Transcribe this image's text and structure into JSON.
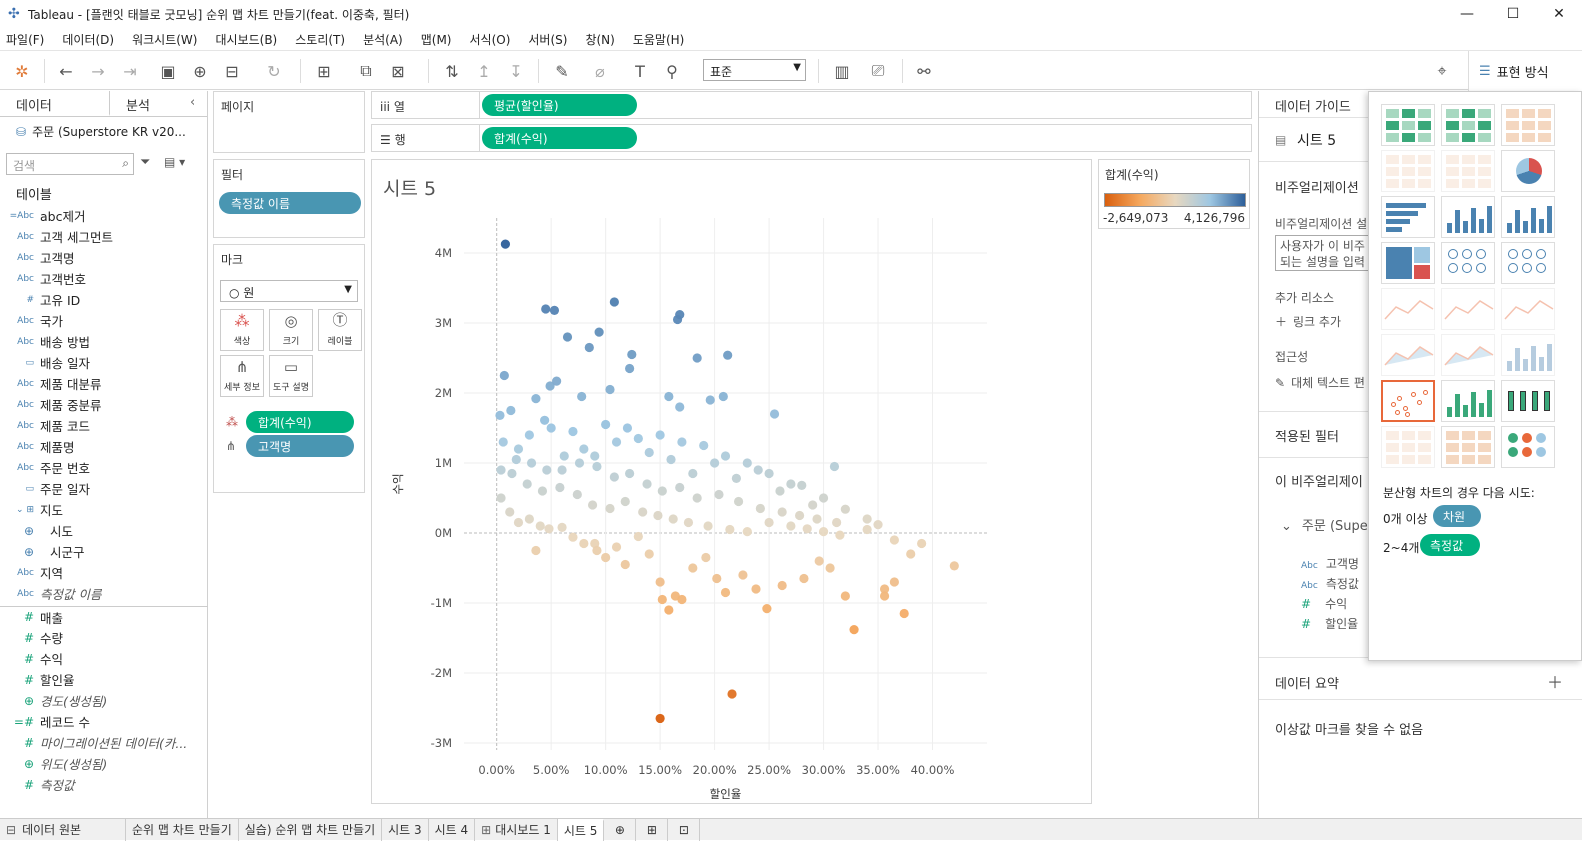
{
  "window": {
    "title": "Tableau - [플랜잇 태블로 굿모닝] 순위 맵 차트 만들기(feat. 이중축, 필터)",
    "minimize": "—",
    "maximize": "☐",
    "close": "✕"
  },
  "menu": [
    "파일(F)",
    "데이터(D)",
    "워크시트(W)",
    "대시보드(B)",
    "스토리(T)",
    "분석(A)",
    "맵(M)",
    "서식(O)",
    "서버(S)",
    "창(N)",
    "도움말(H)"
  ],
  "toolbar": {
    "fit_select": "표준",
    "show_me_label": "표현 방식"
  },
  "left_pane": {
    "tab_data": "데이터",
    "tab_analysis": "분석",
    "datasource": "주문 (Superstore KR v20...",
    "search_placeholder": "검색",
    "tables_label": "테이블",
    "fields": [
      {
        "type": "=Abc",
        "name": "abc제거",
        "style": "dim"
      },
      {
        "type": "Abc",
        "name": "고객 세그먼트",
        "style": "dim"
      },
      {
        "type": "Abc",
        "name": "고객명",
        "style": "dim"
      },
      {
        "type": "Abc",
        "name": "고객번호",
        "style": "dim"
      },
      {
        "type": "#",
        "name": "고유 ID",
        "style": "dim"
      },
      {
        "type": "Abc",
        "name": "국가",
        "style": "dim"
      },
      {
        "type": "Abc",
        "name": "배송 방법",
        "style": "dim"
      },
      {
        "type": "▭",
        "name": "배송 일자",
        "style": "dim"
      },
      {
        "type": "Abc",
        "name": "제품 대분류",
        "style": "dim"
      },
      {
        "type": "Abc",
        "name": "제품 중분류",
        "style": "dim"
      },
      {
        "type": "Abc",
        "name": "제품 코드",
        "style": "dim"
      },
      {
        "type": "Abc",
        "name": "제품명",
        "style": "dim"
      },
      {
        "type": "Abc",
        "name": "주문 번호",
        "style": "dim"
      },
      {
        "type": "▭",
        "name": "주문 일자",
        "style": "dim"
      },
      {
        "type": "⌄ ⊞",
        "name": "지도",
        "style": "dim"
      },
      {
        "type": "⊕",
        "name": "시도",
        "style": "geo"
      },
      {
        "type": "⊕",
        "name": "시군구",
        "style": "geo"
      },
      {
        "type": "Abc",
        "name": "지역",
        "style": "dim"
      },
      {
        "type": "Abc",
        "name": "측정값 이름",
        "style": "dim-italic"
      },
      {
        "type": "#",
        "name": "매출",
        "style": "meas"
      },
      {
        "type": "#",
        "name": "수량",
        "style": "meas"
      },
      {
        "type": "#",
        "name": "수익",
        "style": "meas"
      },
      {
        "type": "#",
        "name": "할인율",
        "style": "meas"
      },
      {
        "type": "⊕",
        "name": "경도(생성됨)",
        "style": "meas-italic"
      },
      {
        "type": "=#",
        "name": "레코드 수",
        "style": "meas"
      },
      {
        "type": "#",
        "name": "마이그레이션된 데이터(카...",
        "style": "meas-italic"
      },
      {
        "type": "⊕",
        "name": "위도(생성됨)",
        "style": "meas-italic"
      },
      {
        "type": "#",
        "name": "측정값",
        "style": "meas-italic"
      }
    ]
  },
  "pages": {
    "title": "페이지"
  },
  "filters": {
    "title": "필터",
    "pill": "측정값 이름"
  },
  "marks": {
    "title": "마크",
    "type": "○ 원",
    "buttons": [
      "색상",
      "크기",
      "레이블",
      "세부 정보",
      "도구 설명"
    ],
    "pill_color": "합계(수익)",
    "pill_detail": "고객명"
  },
  "shelves": {
    "columns_label": "iii 열",
    "columns_pill": "평균(할인율)",
    "rows_label": "☰ 행",
    "rows_pill": "합계(수익)"
  },
  "sheet": {
    "title": "시트 5"
  },
  "legend": {
    "title": "합계(수익)",
    "min": "-2,649,073",
    "max": "4,126,796"
  },
  "colors": {
    "accent_green": "#00b180",
    "pill_blue": "#4996b2",
    "highlight": "#e8683a"
  },
  "chart_data": {
    "type": "scatter",
    "title": "시트 5",
    "xlabel": "할인율",
    "ylabel": "수익",
    "xlim": [
      -0.03,
      0.45
    ],
    "ylim": [
      -3100000,
      4500000
    ],
    "x_ticks": [
      "0.00%",
      "5.00%",
      "10.00%",
      "15.00%",
      "20.00%",
      "25.00%",
      "30.00%",
      "35.00%",
      "40.00%"
    ],
    "x_tick_values": [
      0,
      0.05,
      0.1,
      0.15,
      0.2,
      0.25,
      0.3,
      0.35,
      0.4
    ],
    "y_ticks": [
      "4M",
      "3M",
      "2M",
      "1M",
      "0M",
      "-1M",
      "-2M",
      "-3M"
    ],
    "y_tick_values": [
      4000000,
      3000000,
      2000000,
      1000000,
      0,
      -1000000,
      -2000000,
      -3000000
    ],
    "color_range": [
      -2649073,
      4126796
    ],
    "points": [
      [
        0.008,
        4126796
      ],
      [
        0.045,
        3200000
      ],
      [
        0.053,
        3180000
      ],
      [
        0.108,
        3300000
      ],
      [
        0.166,
        3050000
      ],
      [
        0.168,
        3120000
      ],
      [
        0.065,
        2800000
      ],
      [
        0.094,
        2870000
      ],
      [
        0.085,
        2650000
      ],
      [
        0.122,
        2350000
      ],
      [
        0.124,
        2550000
      ],
      [
        0.184,
        2500000
      ],
      [
        0.212,
        2540000
      ],
      [
        0.007,
        2250000
      ],
      [
        0.049,
        2100000
      ],
      [
        0.055,
        2170000
      ],
      [
        0.078,
        1950000
      ],
      [
        0.104,
        2050000
      ],
      [
        0.158,
        1950000
      ],
      [
        0.168,
        1800000
      ],
      [
        0.196,
        1900000
      ],
      [
        0.208,
        1950000
      ],
      [
        0.255,
        1700000
      ],
      [
        0.003,
        1680000
      ],
      [
        0.013,
        1750000
      ],
      [
        0.036,
        1920000
      ],
      [
        0.044,
        1610000
      ],
      [
        0.004,
        500000
      ],
      [
        0.012,
        300000
      ],
      [
        0.02,
        150000
      ],
      [
        0.03,
        200000
      ],
      [
        0.04,
        100000
      ],
      [
        0.048,
        60000
      ],
      [
        0.06,
        80000
      ],
      [
        0.07,
        -60000
      ],
      [
        0.09,
        -150000
      ],
      [
        0.1,
        -350000
      ],
      [
        0.11,
        -200000
      ],
      [
        0.118,
        -450000
      ],
      [
        0.13,
        -50000
      ],
      [
        0.14,
        -300000
      ],
      [
        0.15,
        -700000
      ],
      [
        0.152,
        -950000
      ],
      [
        0.158,
        -1100000
      ],
      [
        0.164,
        -900000
      ],
      [
        0.17,
        -950000
      ],
      [
        0.18,
        -500000
      ],
      [
        0.192,
        -350000
      ],
      [
        0.202,
        -650000
      ],
      [
        0.21,
        -850000
      ],
      [
        0.226,
        -600000
      ],
      [
        0.238,
        -800000
      ],
      [
        0.248,
        -1080000
      ],
      [
        0.262,
        -750000
      ],
      [
        0.282,
        -650000
      ],
      [
        0.296,
        -400000
      ],
      [
        0.306,
        -500000
      ],
      [
        0.32,
        -900000
      ],
      [
        0.328,
        -1380000
      ],
      [
        0.356,
        -800000
      ],
      [
        0.356,
        -900000
      ],
      [
        0.365,
        -700000
      ],
      [
        0.374,
        -1150000
      ],
      [
        0.42,
        -470000
      ],
      [
        0.15,
        -2649073
      ],
      [
        0.216,
        -2300000
      ],
      [
        0.092,
        -250000
      ],
      [
        0.08,
        -150000
      ],
      [
        0.036,
        -250000
      ],
      [
        0.06,
        900000
      ],
      [
        0.08,
        1200000
      ],
      [
        0.09,
        1100000
      ],
      [
        0.11,
        1300000
      ],
      [
        0.13,
        1350000
      ],
      [
        0.14,
        1150000
      ],
      [
        0.16,
        1050000
      ],
      [
        0.18,
        850000
      ],
      [
        0.2,
        1000000
      ],
      [
        0.22,
        780000
      ],
      [
        0.24,
        900000
      ],
      [
        0.26,
        600000
      ],
      [
        0.28,
        680000
      ],
      [
        0.3,
        500000
      ],
      [
        0.31,
        950000
      ],
      [
        0.32,
        340000
      ],
      [
        0.34,
        200000
      ],
      [
        0.35,
        120000
      ],
      [
        0.365,
        -100000
      ],
      [
        0.38,
        -300000
      ],
      [
        0.39,
        -150000
      ],
      [
        0.02,
        1200000
      ],
      [
        0.03,
        1400000
      ],
      [
        0.05,
        1500000
      ],
      [
        0.07,
        1450000
      ],
      [
        0.1,
        1550000
      ],
      [
        0.12,
        1500000
      ],
      [
        0.15,
        1400000
      ],
      [
        0.17,
        1300000
      ],
      [
        0.19,
        1250000
      ],
      [
        0.21,
        1100000
      ],
      [
        0.23,
        1000000
      ],
      [
        0.25,
        850000
      ],
      [
        0.27,
        700000
      ],
      [
        0.29,
        400000
      ],
      [
        0.004,
        900000
      ],
      [
        0.014,
        850000
      ],
      [
        0.028,
        700000
      ],
      [
        0.042,
        600000
      ],
      [
        0.058,
        650000
      ],
      [
        0.074,
        550000
      ],
      [
        0.088,
        400000
      ],
      [
        0.104,
        350000
      ],
      [
        0.118,
        450000
      ],
      [
        0.134,
        300000
      ],
      [
        0.148,
        250000
      ],
      [
        0.162,
        200000
      ],
      [
        0.176,
        150000
      ],
      [
        0.194,
        100000
      ],
      [
        0.214,
        50000
      ],
      [
        0.23,
        20000
      ],
      [
        0.25,
        150000
      ],
      [
        0.27,
        100000
      ],
      [
        0.285,
        60000
      ],
      [
        0.3,
        20000
      ],
      [
        0.315,
        -30000
      ],
      [
        0.006,
        1300000
      ],
      [
        0.018,
        1050000
      ],
      [
        0.032,
        1000000
      ],
      [
        0.046,
        900000
      ],
      [
        0.062,
        1100000
      ],
      [
        0.076,
        1000000
      ],
      [
        0.092,
        950000
      ],
      [
        0.108,
        800000
      ],
      [
        0.122,
        850000
      ],
      [
        0.138,
        700000
      ],
      [
        0.152,
        600000
      ],
      [
        0.168,
        650000
      ],
      [
        0.184,
        500000
      ],
      [
        0.204,
        550000
      ],
      [
        0.222,
        450000
      ],
      [
        0.242,
        350000
      ],
      [
        0.262,
        300000
      ],
      [
        0.278,
        250000
      ],
      [
        0.294,
        200000
      ],
      [
        0.312,
        150000
      ],
      [
        0.34,
        50000
      ]
    ]
  },
  "data_guide": {
    "title": "데이터 가이드",
    "sheet": "시트 5",
    "viz_desc_header": "비주얼리제이션",
    "viz_desc_label": "비주얼리제이션 설",
    "desc_placeholder_line1": "사용자가 이 비주",
    "desc_placeholder_line2": "되는 설명을 입력",
    "extra_resources": "추가 리소스",
    "add_link": "링크 추가",
    "accessibility": "접근성",
    "alt_text": "대체 텍스트 편",
    "applied_filters": "적용된 필터",
    "this_viz": "이 비주얼리제이",
    "source": "주문 (Supe",
    "source_fields": [
      {
        "type": "Abc",
        "name": "고객명"
      },
      {
        "type": "Abc",
        "name": "측정값"
      },
      {
        "type": "#",
        "name": "수익"
      },
      {
        "type": "#",
        "name": "할인율"
      }
    ],
    "data_summary": "데이터 요약",
    "outliers": "이상값 마크를 찾을 수 없음"
  },
  "show_me": {
    "hint": "분산형 차트의 경우 다음 시도:",
    "req1_label": "0개 이상",
    "req1_pill": "차원",
    "req2_label": "2~4개",
    "req2_pill": "측정값"
  },
  "bottom_tabs": {
    "datasource_tab": "데이터 원본",
    "sheets": [
      "순위 맵 차트 만들기",
      "실습) 순위 맵 차트 만들기",
      "시트 3",
      "시트 4",
      "대시보드 1",
      "시트 5"
    ],
    "active_index": 5
  }
}
